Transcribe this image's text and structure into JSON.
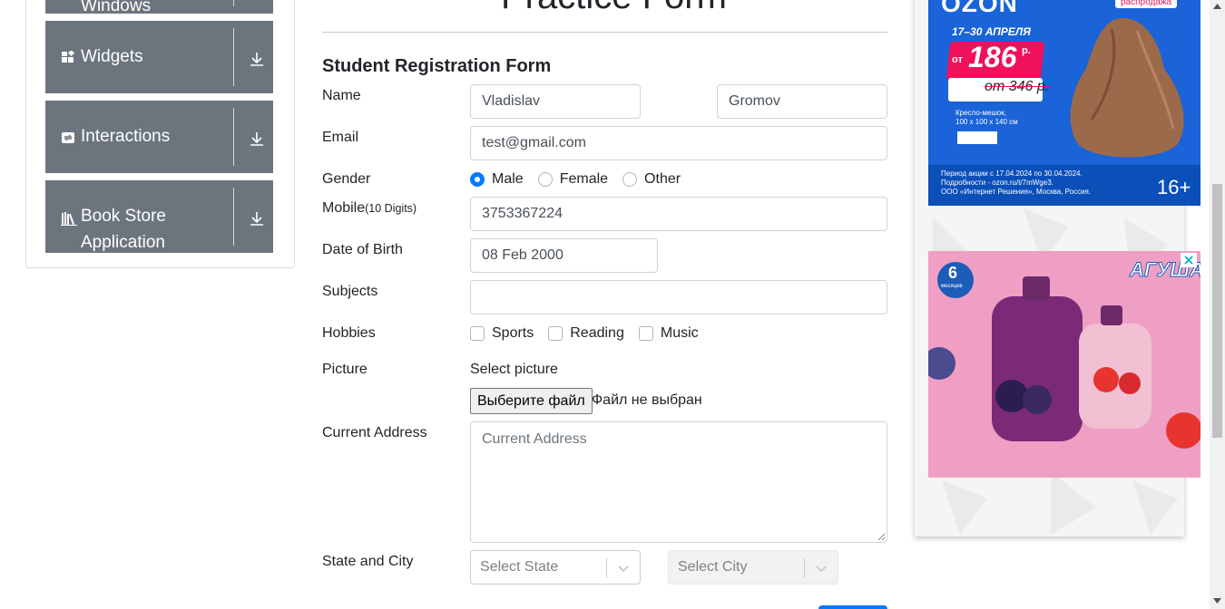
{
  "sidebar": {
    "groups": [
      {
        "label": "Windows",
        "icon": "window-icon"
      },
      {
        "label": "Widgets",
        "icon": "widgets-icon"
      },
      {
        "label": "Interactions",
        "icon": "interactions-icon"
      },
      {
        "label": "Book Store",
        "label2": "Application",
        "icon": "books-icon"
      }
    ]
  },
  "form": {
    "page_title": "Practice Form",
    "title": "Student Registration Form",
    "labels": {
      "name": "Name",
      "email": "Email",
      "gender": "Gender",
      "mobile": "Mobile",
      "mobile_hint": "(10 Digits)",
      "dob": "Date of Birth",
      "subjects": "Subjects",
      "hobbies": "Hobbies",
      "picture": "Picture",
      "address": "Current Address",
      "state_city": "State and City"
    },
    "values": {
      "first_name": "Vladislav",
      "last_name": "Gromov",
      "email": "test@gmail.com",
      "mobile": "3753367224",
      "dob": "08 Feb 2000",
      "subjects": ""
    },
    "gender_options": [
      "Male",
      "Female",
      "Other"
    ],
    "gender_selected": "Male",
    "hobby_options": [
      "Sports",
      "Reading",
      "Music"
    ],
    "picture_prompt": "Select picture",
    "file_button": "Выберите файл",
    "file_status": "Файл не выбран",
    "address_placeholder": "Current Address",
    "state_placeholder": "Select State",
    "city_placeholder": "Select City"
  },
  "ads": {
    "ozon": {
      "brand": "OZON",
      "tag": "распродажа",
      "dates": "17–30 АПРЕЛЯ",
      "price_prefix": "от",
      "price": "186",
      "currency": "р.",
      "old_price": "от 346 р.",
      "product": "Кресло-мешок,",
      "size": "100 х 100 х 140 см",
      "fine1": "Период акции с 17.04.2024 по 30.04.2024.",
      "fine2": "Подробности - ozon.ru/t/7mWge3.",
      "fine3": "ООО «Интернет Решения», Москва, Россия.",
      "age": "16+"
    },
    "agusha": {
      "brand": "АГУША",
      "age_badge": "6",
      "age_unit": "месяцев"
    }
  }
}
